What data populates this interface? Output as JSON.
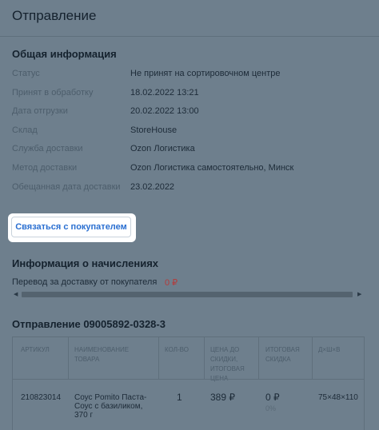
{
  "header": {
    "title": "Отправление"
  },
  "general": {
    "heading": "Общая информация",
    "rows": [
      {
        "label": "Статус",
        "value": "Не принят на сортировочном центре"
      },
      {
        "label": "Принят в обработку",
        "value": "18.02.2022 13:21"
      },
      {
        "label": "Дата отгрузки",
        "value": "20.02.2022 13:00"
      },
      {
        "label": "Склад",
        "value": "StoreHouse"
      },
      {
        "label": "Служба доставки",
        "value": "Ozon Логистика"
      },
      {
        "label": "Метод доставки",
        "value": "Ozon Логистика самостоятельно, Минск"
      },
      {
        "label": "Обещанная дата доставки",
        "value": "23.02.2022"
      }
    ]
  },
  "contact_button": {
    "label": "Связаться с покупателем"
  },
  "charges": {
    "heading": "Информация о начислениях",
    "delivery_label": "Перевод за доставку от покупателя",
    "delivery_value": "0 ₽"
  },
  "shipment": {
    "heading": "Отправление 09005892-0328-3",
    "columns": [
      "АРТИКУЛ",
      "НАИМЕНОВАНИЕ\nТОВАРА",
      "КОЛ-ВО",
      "ЦЕНА ДО\nСКИДКИ,\nИТОГОВАЯ\nЦЕНА",
      "ИТОГОВАЯ\nСКИДКА",
      "Д×Ш×В"
    ],
    "rows": [
      {
        "sku": "210823014",
        "name": "Соус Pomito Паста-Соус с базиликом, 370 г",
        "qty": "1",
        "price": "389 ₽",
        "discount": "0 ₽",
        "discount_pct": "0%",
        "dims": "75×48×110"
      }
    ]
  },
  "colors": {
    "accent": "#2a6fd1",
    "overlay": "#6e7f8d",
    "negative": "#b43a3a"
  }
}
